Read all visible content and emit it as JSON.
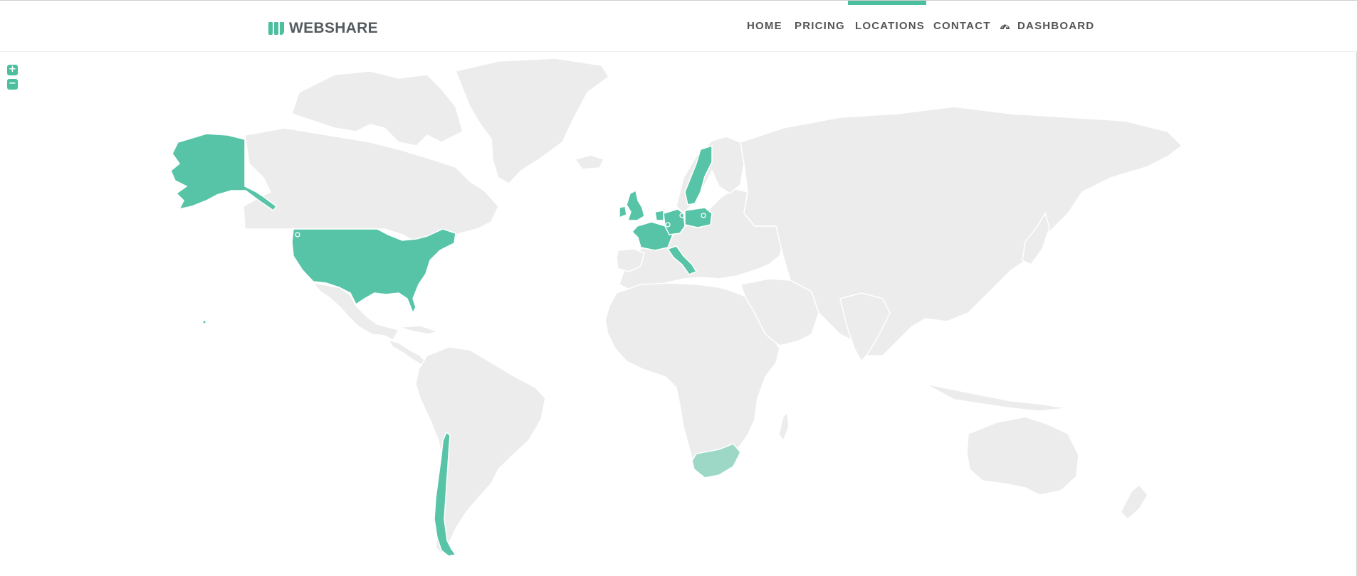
{
  "brand": {
    "name": "WEBSHARE",
    "accent_color": "#4cbf9e",
    "logo_icon": "webshare-logo-icon"
  },
  "nav": {
    "items": [
      {
        "label": "HOME",
        "active": false
      },
      {
        "label": "PRICING",
        "active": false
      },
      {
        "label": "LOCATIONS",
        "active": true
      },
      {
        "label": "CONTACT",
        "active": false
      },
      {
        "label": "DASHBOARD",
        "active": false,
        "icon": "dashboard-gauge-icon"
      }
    ]
  },
  "map_controls": {
    "zoom_in": "+",
    "zoom_out": "−"
  },
  "map": {
    "base_color": "#ececec",
    "highlight_color": "#57c4a7",
    "partial_color": "#9dd8c6",
    "highlighted_regions": [
      "United States",
      "Alaska",
      "Hawaii",
      "Chile",
      "United Kingdom",
      "France",
      "Germany",
      "Netherlands",
      "Poland",
      "Sweden",
      "Italy",
      "South Africa"
    ]
  }
}
